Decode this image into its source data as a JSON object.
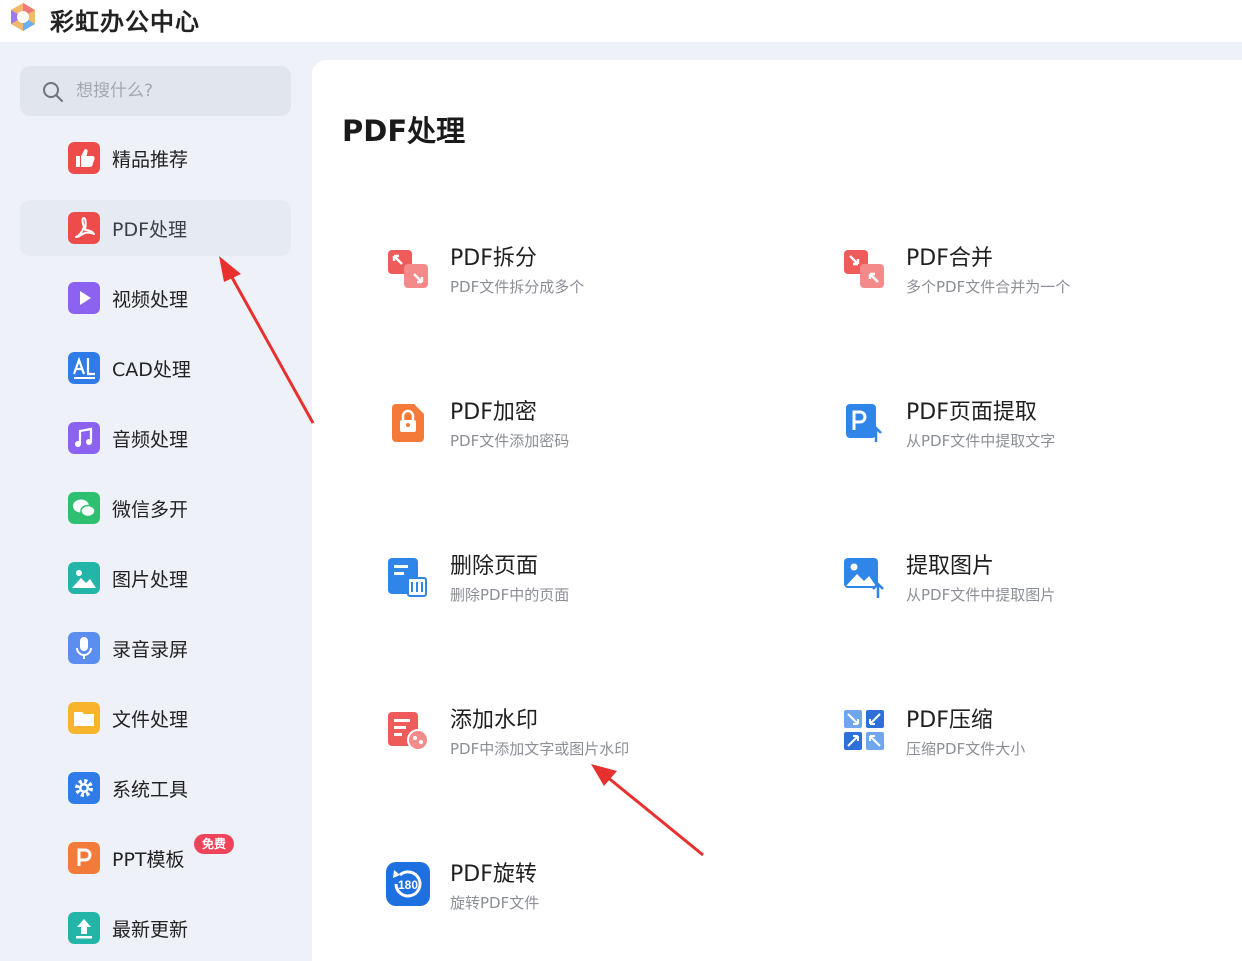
{
  "app": {
    "title": "彩虹办公中心"
  },
  "search": {
    "placeholder": "想搜什么?"
  },
  "sidebar": {
    "items": [
      {
        "label": "精品推荐",
        "icon": "thumbs-up-icon",
        "color": "#ee4b4b"
      },
      {
        "label": "PDF处理",
        "icon": "pdf-icon",
        "color": "#ee4b4b",
        "active": true
      },
      {
        "label": "视频处理",
        "icon": "play-icon",
        "color": "#8c62f0"
      },
      {
        "label": "CAD处理",
        "icon": "cad-icon",
        "color": "#2f7be8"
      },
      {
        "label": "音频处理",
        "icon": "music-icon",
        "color": "#8c62f0"
      },
      {
        "label": "微信多开",
        "icon": "wechat-icon",
        "color": "#2fbf71"
      },
      {
        "label": "图片处理",
        "icon": "image-icon",
        "color": "#22b5a8"
      },
      {
        "label": "录音录屏",
        "icon": "microphone-icon",
        "color": "#5c8ef0"
      },
      {
        "label": "文件处理",
        "icon": "folder-icon",
        "color": "#f7b42c"
      },
      {
        "label": "系统工具",
        "icon": "gear-icon",
        "color": "#2f7be8"
      },
      {
        "label": "PPT模板",
        "icon": "ppt-icon",
        "color": "#f27a3a",
        "badge": "免费"
      },
      {
        "label": "最新更新",
        "icon": "upload-icon",
        "color": "#22b5a8"
      }
    ]
  },
  "main": {
    "title": "PDF处理",
    "tools": [
      {
        "title": "PDF拆分",
        "desc": "PDF文件拆分成多个",
        "icon": "split-icon"
      },
      {
        "title": "PDF合并",
        "desc": "多个PDF文件合并为一个",
        "icon": "merge-icon"
      },
      {
        "title": "PDF加密",
        "desc": "PDF文件添加密码",
        "icon": "lock-icon"
      },
      {
        "title": "PDF页面提取",
        "desc": "从PDF文件中提取文字",
        "icon": "page-extract-icon"
      },
      {
        "title": "删除页面",
        "desc": "删除PDF中的页面",
        "icon": "delete-page-icon"
      },
      {
        "title": "提取图片",
        "desc": "从PDF文件中提取图片",
        "icon": "extract-image-icon"
      },
      {
        "title": "添加水印",
        "desc": "PDF中添加文字或图片水印",
        "icon": "watermark-icon"
      },
      {
        "title": "PDF压缩",
        "desc": "压缩PDF文件大小",
        "icon": "compress-icon"
      },
      {
        "title": "PDF旋转",
        "desc": "旋转PDF文件",
        "icon": "rotate-icon"
      }
    ]
  },
  "annotations": {
    "arrow_color": "#e8312f"
  }
}
